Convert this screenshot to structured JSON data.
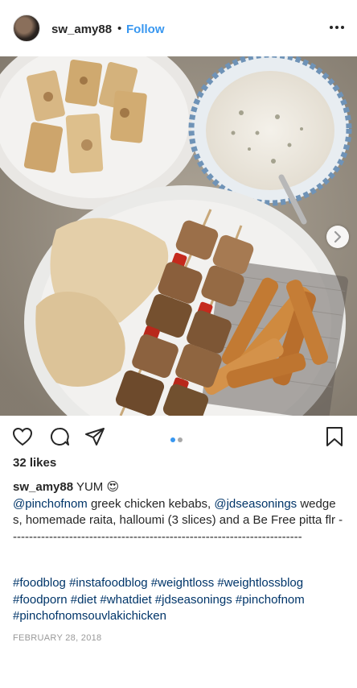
{
  "header": {
    "username": "sw_amy88",
    "separator": "•",
    "follow_label": "Follow",
    "avatar_icon": "user-avatar",
    "more_icon": "more-horizontal-icon"
  },
  "photo": {
    "alt": "greek chicken kebabs with wedges, raita, halloumi and pitta",
    "next_icon": "chevron-right-icon"
  },
  "actions": {
    "icons": [
      "heart-icon",
      "comment-icon",
      "share-icon",
      "bookmark-icon"
    ],
    "carousel_count": 2,
    "carousel_active": 1,
    "active_color": "#3897f0",
    "inactive_color": "#a8a8a8"
  },
  "likes": {
    "text": "32 likes"
  },
  "caption": {
    "username": "sw_amy88",
    "text_1": " YUM 😍",
    "mention_1": "@pinchofnom",
    "text_2": " greek chicken kebabs, ",
    "mention_2": "@jdseasonings",
    "text_3": " wedges, homemade raita, halloumi (3 slices) and a Be Free pitta flr -------------------------------------------------------------------------"
  },
  "hashtags": {
    "text": "#foodblog #instafoodblog #weightloss #weightlossblog #foodporn #diet #whatdiet #jdseasonings #pinchofnom #pinchofnomsouvlakichicken"
  },
  "date": {
    "text": "FEBRUARY 28, 2018"
  },
  "colors": {
    "link": "#003569",
    "follow": "#3897f0",
    "text": "#262626",
    "muted": "#999999"
  }
}
